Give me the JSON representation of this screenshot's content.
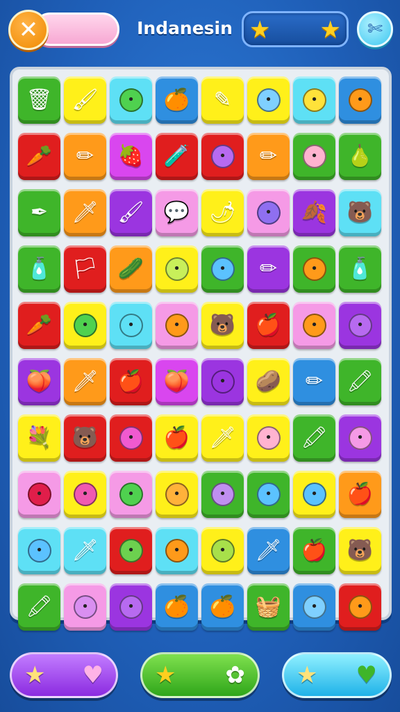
{
  "header": {
    "close_glyph": "✕",
    "level_title": "Indanesin",
    "star_glyph": "★",
    "settings_glyph": "✄"
  },
  "colors": {
    "green": "#3fb52a",
    "yellow": "#fff01a",
    "cyan": "#5ee0f5",
    "blue": "#2f8fe0",
    "red": "#e01e1e",
    "orange": "#ff9a1a",
    "pink": "#f59ae6",
    "purple": "#9b35e0",
    "magenta": "#d946ef"
  },
  "board": {
    "rows": [
      [
        {
          "c": "green",
          "i": "🗑",
          "n": "trash-can-icon"
        },
        {
          "c": "yellow",
          "i": "🖌",
          "n": "brush-icon"
        },
        {
          "c": "cyan",
          "i": "•",
          "n": "face-icon",
          "f": "#4fd14f"
        },
        {
          "c": "blue",
          "i": "🍊",
          "n": "orange-fruit-icon"
        },
        {
          "c": "yellow",
          "i": "✎",
          "n": "pencil-icon"
        },
        {
          "c": "yellow",
          "i": "•",
          "n": "face-icon",
          "f": "#7fd0ff"
        },
        {
          "c": "cyan",
          "i": "•",
          "n": "face-icon",
          "f": "#ffe23a"
        },
        {
          "c": "blue",
          "i": "•",
          "n": "face-icon",
          "f": "#ff9a1a"
        }
      ],
      [
        {
          "c": "red",
          "i": "🥕",
          "n": "carrot-icon"
        },
        {
          "c": "orange",
          "i": "✏",
          "n": "pencil-icon"
        },
        {
          "c": "magenta",
          "i": "🍓",
          "n": "berry-icon"
        },
        {
          "c": "red",
          "i": "🧪",
          "n": "flask-icon"
        },
        {
          "c": "red",
          "i": "•",
          "n": "face-icon",
          "f": "#b76af0"
        },
        {
          "c": "orange",
          "i": "✏",
          "n": "crayon-icon"
        },
        {
          "c": "green",
          "i": "•",
          "n": "face-icon",
          "f": "#ffb3d0"
        },
        {
          "c": "green",
          "i": "🍐",
          "n": "fruit-icon"
        }
      ],
      [
        {
          "c": "green",
          "i": "✒",
          "n": "quill-icon"
        },
        {
          "c": "orange",
          "i": "🗡",
          "n": "sword-icon"
        },
        {
          "c": "purple",
          "i": "🖌",
          "n": "brush-icon"
        },
        {
          "c": "pink",
          "i": "💬",
          "n": "speech-bubble-icon"
        },
        {
          "c": "yellow",
          "i": "🌶",
          "n": "pepper-icon"
        },
        {
          "c": "pink",
          "i": "•",
          "n": "face-icon",
          "f": "#8f6ff0"
        },
        {
          "c": "purple",
          "i": "🍂",
          "n": "leaf-bouquet-icon"
        },
        {
          "c": "cyan",
          "i": "🐻",
          "n": "bear-icon"
        }
      ],
      [
        {
          "c": "green",
          "i": "🧴",
          "n": "bottle-icon"
        },
        {
          "c": "red",
          "i": "🏳",
          "n": "flag-icon"
        },
        {
          "c": "orange",
          "i": "🥒",
          "n": "cucumber-icon"
        },
        {
          "c": "yellow",
          "i": "•",
          "n": "face-icon",
          "f": "#c8ef5a"
        },
        {
          "c": "green",
          "i": "•",
          "n": "face-icon",
          "f": "#5bc2ff"
        },
        {
          "c": "purple",
          "i": "✏",
          "n": "pencil-icon"
        },
        {
          "c": "green",
          "i": "•",
          "n": "face-icon",
          "f": "#ff9a1a"
        },
        {
          "c": "green",
          "i": "🧴",
          "n": "bottle-icon"
        }
      ],
      [
        {
          "c": "red",
          "i": "🥕",
          "n": "carrot-icon"
        },
        {
          "c": "yellow",
          "i": "•",
          "n": "face-icon",
          "f": "#4fd14f"
        },
        {
          "c": "cyan",
          "i": "•",
          "n": "face-icon",
          "f": "#5ee0f5"
        },
        {
          "c": "pink",
          "i": "•",
          "n": "face-icon",
          "f": "#ff9a1a"
        },
        {
          "c": "yellow",
          "i": "🐻",
          "n": "bear-icon"
        },
        {
          "c": "red",
          "i": "🍎",
          "n": "apple-icon"
        },
        {
          "c": "pink",
          "i": "•",
          "n": "face-icon",
          "f": "#ff9a1a"
        },
        {
          "c": "purple",
          "i": "•",
          "n": "face-icon",
          "f": "#b76af0"
        }
      ],
      [
        {
          "c": "purple",
          "i": "🍑",
          "n": "berry-icon"
        },
        {
          "c": "orange",
          "i": "🗡",
          "n": "sword-icon"
        },
        {
          "c": "red",
          "i": "🍎",
          "n": "apple-icon"
        },
        {
          "c": "magenta",
          "i": "🍑",
          "n": "berry-icon"
        },
        {
          "c": "purple",
          "i": "•",
          "n": "face-icon",
          "f": "#9b35e0"
        },
        {
          "c": "yellow",
          "i": "🥔",
          "n": "potato-icon"
        },
        {
          "c": "blue",
          "i": "✏",
          "n": "pencil-icon"
        },
        {
          "c": "green",
          "i": "🖍",
          "n": "crayon-icon"
        }
      ],
      [
        {
          "c": "yellow",
          "i": "💐",
          "n": "bouquet-icon"
        },
        {
          "c": "red",
          "i": "🐻",
          "n": "bear-icon"
        },
        {
          "c": "red",
          "i": "•",
          "n": "face-icon",
          "f": "#f05ad0"
        },
        {
          "c": "yellow",
          "i": "🍎",
          "n": "apple-icon"
        },
        {
          "c": "yellow",
          "i": "🗡",
          "n": "sword-icon"
        },
        {
          "c": "yellow",
          "i": "•",
          "n": "face-icon",
          "f": "#ffb3d0"
        },
        {
          "c": "green",
          "i": "🖍",
          "n": "crayon-icon"
        },
        {
          "c": "purple",
          "i": "•",
          "n": "face-icon",
          "f": "#f59ae6"
        }
      ],
      [
        {
          "c": "pink",
          "i": "•",
          "n": "face-icon",
          "f": "#e01e4a"
        },
        {
          "c": "yellow",
          "i": "•",
          "n": "face-icon",
          "f": "#f05ab0"
        },
        {
          "c": "pink",
          "i": "•",
          "n": "face-icon",
          "f": "#4fd14f"
        },
        {
          "c": "yellow",
          "i": "•",
          "n": "face-icon",
          "f": "#ffb23a"
        },
        {
          "c": "green",
          "i": "•",
          "n": "face-icon",
          "f": "#c08ff0"
        },
        {
          "c": "green",
          "i": "•",
          "n": "face-icon",
          "f": "#5bc2ff"
        },
        {
          "c": "yellow",
          "i": "•",
          "n": "face-icon",
          "f": "#5bc2ff"
        },
        {
          "c": "orange",
          "i": "🍎",
          "n": "apple-icon"
        }
      ],
      [
        {
          "c": "cyan",
          "i": "•",
          "n": "face-icon",
          "f": "#5bc2ff"
        },
        {
          "c": "cyan",
          "i": "🗡",
          "n": "sword-icon"
        },
        {
          "c": "red",
          "i": "•",
          "n": "face-icon",
          "f": "#6cd14f"
        },
        {
          "c": "cyan",
          "i": "•",
          "n": "face-icon",
          "f": "#ff9a1a"
        },
        {
          "c": "yellow",
          "i": "•",
          "n": "face-icon",
          "f": "#a8e04a"
        },
        {
          "c": "blue",
          "i": "🗡",
          "n": "sword-icon"
        },
        {
          "c": "green",
          "i": "🍎",
          "n": "apple-icon"
        },
        {
          "c": "yellow",
          "i": "🐻",
          "n": "bear-icon"
        }
      ],
      [
        {
          "c": "green",
          "i": "🖍",
          "n": "crayon-icon"
        },
        {
          "c": "pink",
          "i": "•",
          "n": "face-icon",
          "f": "#d98ff0"
        },
        {
          "c": "purple",
          "i": "•",
          "n": "face-icon",
          "f": "#b76af0"
        },
        {
          "c": "blue",
          "i": "🍊",
          "n": "orange-fruit-icon"
        },
        {
          "c": "blue",
          "i": "🍊",
          "n": "orange-fruit-icon"
        },
        {
          "c": "green",
          "i": "🧺",
          "n": "basket-icon"
        },
        {
          "c": "blue",
          "i": "•",
          "n": "face-icon",
          "f": "#7fd0ff"
        },
        {
          "c": "red",
          "i": "•",
          "n": "face-icon",
          "f": "#ff9a1a"
        }
      ]
    ]
  },
  "bottom": {
    "left": {
      "icon_a": "★",
      "icon_b": "♥"
    },
    "mid": {
      "icon_a": "★",
      "icon_b": "✿"
    },
    "right": {
      "icon_a": "★",
      "icon_b": "♥"
    }
  }
}
